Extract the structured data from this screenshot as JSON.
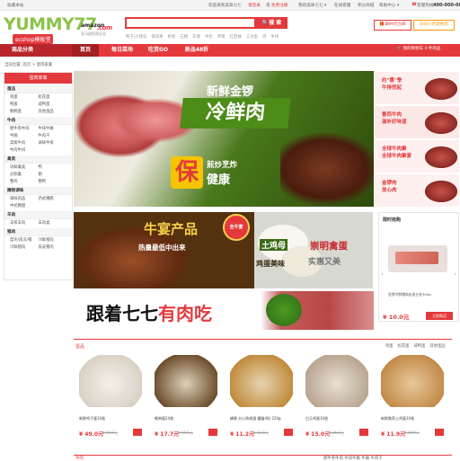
{
  "topbar": {
    "bookmark": "收藏本站",
    "welcome": "欢迎来到美味七七",
    "login": "请登录",
    "or": "或",
    "register": "免费注册",
    "my": "我的美味七七 ▾",
    "service": "在线客服",
    "points": "积分商城",
    "help": "帮助中心 ▾",
    "phone_label": "客服热线：",
    "phone": "400-000-0000"
  },
  "header": {
    "logo_main": "YUMMY77",
    "logo_com": ".com",
    "logo_sub": "ecshop模板堂",
    "amazon": "amazon",
    "amazon_sub": "亚马逊投资企业",
    "search_placeholder": "",
    "search_button": "搜 索",
    "hotwords": [
      "鸭子|小建议",
      "夜闲果",
      "虾程",
      "石榴",
      "车厘",
      "牛奶",
      "草莓",
      "红西柚",
      "三文鱼",
      "鸡",
      "牛排"
    ],
    "promo1": "满99元包邮",
    "promo2": "48小时退换货",
    "cart": "我的购物车 0 件商品"
  },
  "nav": {
    "category_title": "商品分类",
    "items": [
      "首页",
      "每日菜场",
      "吃货GO",
      "新品48折"
    ]
  },
  "breadcrumb": "当前位置: 首页 > 蛋肉家禽",
  "sidebar": {
    "title": "蛋肉家禽",
    "groups": [
      {
        "title": "蛋品",
        "links": [
          "鸡蛋",
          "松花蛋",
          "鸭蛋",
          "咸鸭蛋",
          "鹌鹑蛋",
          "其他蛋品"
        ]
      },
      {
        "title": "牛肉",
        "links": [
          "肥牛卷牛肉",
          "牛排牛尾",
          "牛腩",
          "牛肉干",
          "菜肴牛肉",
          "调味牛排",
          "牛肉牛排"
        ]
      },
      {
        "title": "禽类",
        "links": [
          "冰鲜禽类",
          "鸭",
          "分割禽",
          "鹅",
          "整鸡",
          "整鸭"
        ]
      },
      {
        "title": "腌制调味",
        "links": [
          "调味肉品",
          "西式腌腊",
          "中式腌腊"
        ]
      },
      {
        "title": "羊肉",
        "links": [
          "羊排羊肉",
          "羊肉类"
        ]
      },
      {
        "title": "猪肉",
        "links": [
          "菜毛/肉冻/猪",
          "冷鲜猪肉",
          "冷鲜猪肉",
          "去皮猪肉"
        ]
      }
    ]
  },
  "banner": {
    "line1": "新鲜金锣",
    "line2": "冷鲜肉",
    "line3": "保",
    "line4": "煎炒烹炸",
    "line5": "健康"
  },
  "right_promos": [
    {
      "text": "约\"惠\"季\n牛排挖起",
      "color": "#e4393c",
      "bg": "#fdeeee"
    },
    {
      "text": "鲁西牛肉\n滋补好味道",
      "color": "#e4393c",
      "bg": "#fbe8e6"
    },
    {
      "text": "全球牛肉聚\n全球牛肉聚宴",
      "color": "#e4393c",
      "bg": "#fff0f0"
    },
    {
      "text": "金锣肉\n放心肉",
      "color": "#e4393c",
      "bg": "#fdf0ef"
    }
  ],
  "promo_row": {
    "niuyan_t1": "牛宴产品",
    "niuyan_t2": "热量最低中出来",
    "badge": "全牛宴",
    "eggs_t1": "土鸡母",
    "eggs_t2": "鸡蛋美味",
    "eggs_t3": "崇明禽蛋",
    "eggs_t4": "实惠又美"
  },
  "flash_sale": {
    "title": "限时抢购",
    "product": "金锣冷鲜猪肉去皮五花300g",
    "price": "¥ 10.0元",
    "button": "立即购买"
  },
  "follow_banner": {
    "text_a": "跟着七七",
    "text_b": "有肉吃"
  },
  "section": {
    "title": "蛋品",
    "tags": [
      "鸡蛋",
      "松花蛋",
      "咸鸭蛋",
      "其他蛋品"
    ]
  },
  "products": [
    {
      "name": "新鲜鸡子蛋10枚",
      "price": "¥ 49.0元",
      "old": "¥ 98.0元",
      "color": "#f4f1ea",
      "accent": "#d8d0c4"
    },
    {
      "name": "鹌鹑蛋24枚",
      "price": "¥ 17.7元",
      "old": "¥ 16.9元",
      "color": "#ded1ba",
      "accent": "#6b4b2a"
    },
    {
      "name": "蜂蜜 红心熟咸蛋 罐盒4粒 220g",
      "price": "¥ 11.2元",
      "old": "¥ 12.8元",
      "color": "#e6d3b0",
      "accent": "#c08a3a"
    },
    {
      "name": "白玉鸡蛋10枚",
      "price": "¥ 15.0元",
      "old": "¥ 16.0元",
      "color": "#e8e0d2",
      "accent": "#b8a590"
    },
    {
      "name": "新鲜散养土鸡蛋10枚",
      "price": "¥ 11.9元",
      "old": "¥ 16.9元",
      "color": "#e8c79a",
      "accent": "#c28a48"
    }
  ],
  "section2": {
    "title": "牛肉",
    "tags": "肥牛卷牛肉  牛排牛尾  牛腩  牛肉干"
  }
}
